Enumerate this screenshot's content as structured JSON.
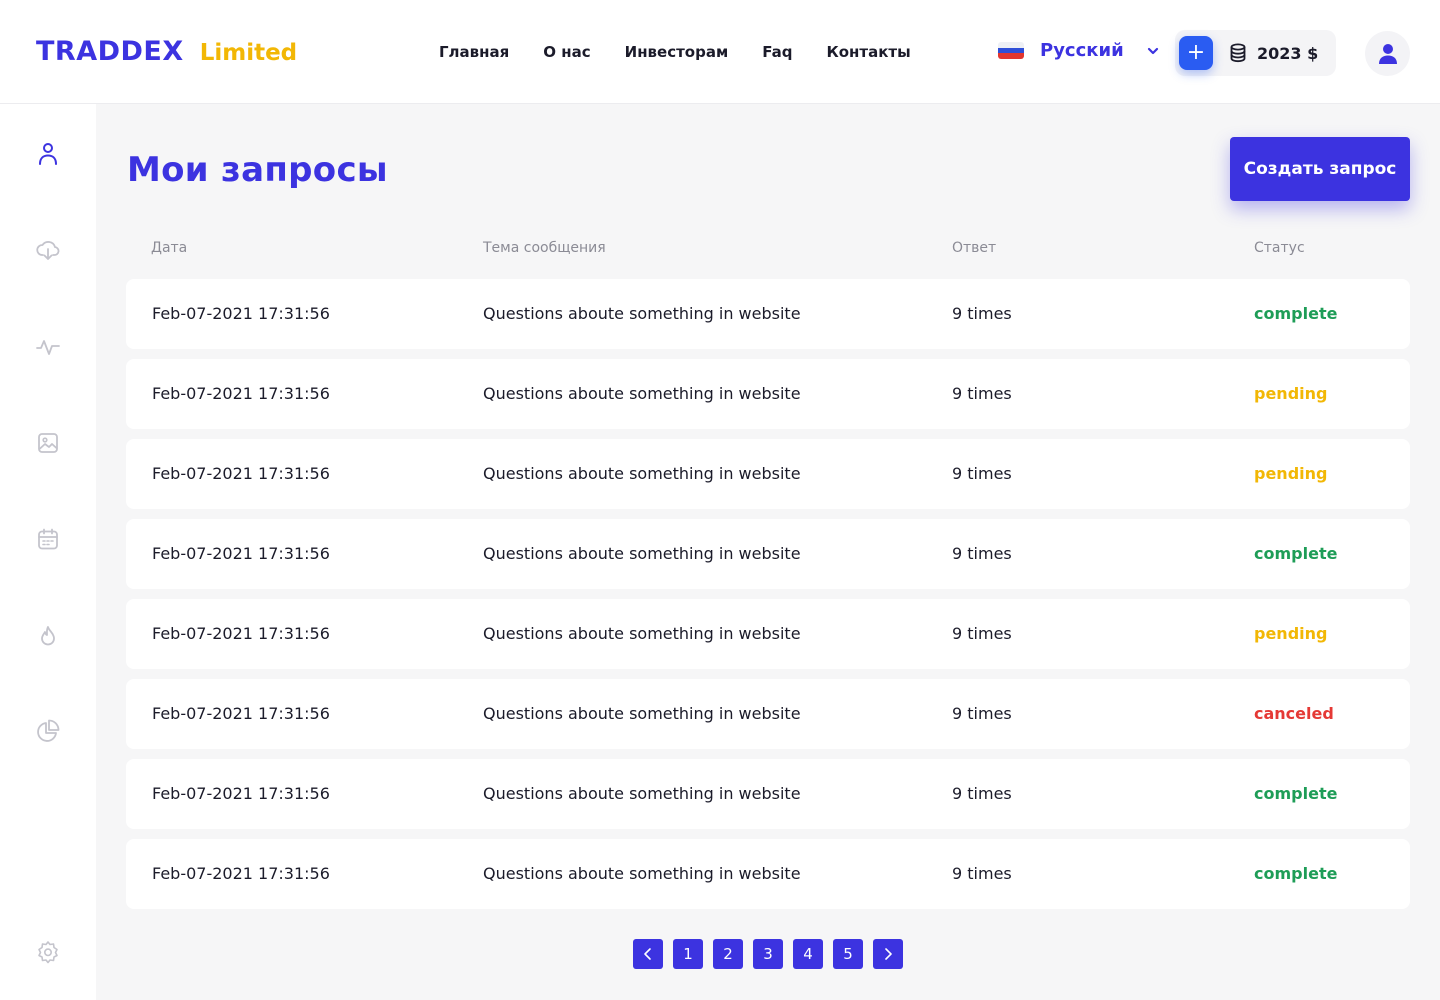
{
  "brand": {
    "name": "TRADDEX",
    "suffix": "Limited"
  },
  "nav": [
    "Главная",
    "О нас",
    "Инвесторам",
    "Faq",
    "Контакты"
  ],
  "language": {
    "label": "Русский",
    "flag_icon": "russia-flag-icon"
  },
  "wallet": {
    "add_label": "+",
    "balance": "2023 $"
  },
  "sidebar_icons": [
    "user-icon",
    "cloud-download-icon",
    "activity-icon",
    "image-icon",
    "calendar-icon",
    "flame-icon",
    "pie-chart-icon",
    "settings-icon"
  ],
  "page": {
    "title": "Мои запросы",
    "create_button": "Создать запрос"
  },
  "table": {
    "headers": {
      "date": "Дата",
      "topic": "Тема сообщения",
      "answer": "Ответ",
      "status": "Статус"
    },
    "rows": [
      {
        "date": "Feb-07-2021  17:31:56",
        "topic": "Questions aboute something in website",
        "answer": "9 times",
        "status": "complete"
      },
      {
        "date": "Feb-07-2021  17:31:56",
        "topic": "Questions aboute something in website",
        "answer": "9 times",
        "status": "pending"
      },
      {
        "date": "Feb-07-2021  17:31:56",
        "topic": "Questions aboute something in website",
        "answer": "9 times",
        "status": "pending"
      },
      {
        "date": "Feb-07-2021  17:31:56",
        "topic": "Questions aboute something in website",
        "answer": "9 times",
        "status": "complete"
      },
      {
        "date": "Feb-07-2021  17:31:56",
        "topic": "Questions aboute something in website",
        "answer": "9 times",
        "status": "pending"
      },
      {
        "date": "Feb-07-2021  17:31:56",
        "topic": "Questions aboute something in website",
        "answer": "9 times",
        "status": "canceled"
      },
      {
        "date": "Feb-07-2021  17:31:56",
        "topic": "Questions aboute something in website",
        "answer": "9 times",
        "status": "complete"
      },
      {
        "date": "Feb-07-2021  17:31:56",
        "topic": "Questions aboute something in website",
        "answer": "9 times",
        "status": "complete"
      }
    ]
  },
  "pagination": {
    "pages": [
      "1",
      "2",
      "3",
      "4",
      "5"
    ]
  },
  "colors": {
    "accent": "#3c33e0",
    "gold": "#f2b705",
    "complete": "#1e9d57",
    "pending": "#f2b705",
    "canceled": "#e53935"
  }
}
